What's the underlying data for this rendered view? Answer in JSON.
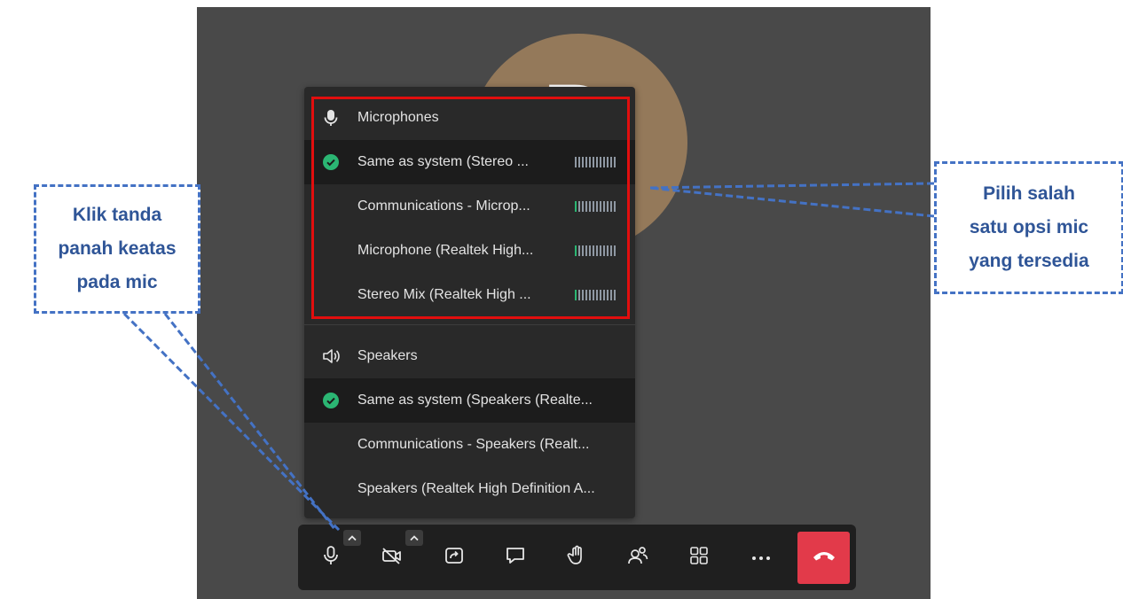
{
  "menu": {
    "microphones": {
      "header": "Microphones",
      "items": [
        {
          "label": "Same as system (Stereo ...",
          "selected": true,
          "level": 0
        },
        {
          "label": "Communications - Microp...",
          "selected": false,
          "level": 1
        },
        {
          "label": "Microphone (Realtek High...",
          "selected": false,
          "level": 1
        },
        {
          "label": "Stereo Mix (Realtek High ...",
          "selected": false,
          "level": 1
        }
      ]
    },
    "speakers": {
      "header": "Speakers",
      "items": [
        {
          "label": "Same as system (Speakers (Realte...",
          "selected": true
        },
        {
          "label": "Communications - Speakers (Realt...",
          "selected": false
        },
        {
          "label": "Speakers (Realtek High Definition A...",
          "selected": false
        }
      ]
    }
  },
  "avatar": {
    "initial": "B",
    "color": "#94795a"
  },
  "toolbar": {
    "buttons": [
      "mic-icon",
      "camera-off-icon",
      "share-screen-icon",
      "chat-icon",
      "raise-hand-icon",
      "participants-icon",
      "grid-view-icon",
      "more-icon",
      "hang-up-icon"
    ]
  },
  "annotations": {
    "left_lines": [
      "Klik tanda",
      "panah keatas",
      "pada mic"
    ],
    "right_lines": [
      "Pilih salah",
      "satu opsi mic",
      "yang tersedia"
    ]
  },
  "colors": {
    "stage_bg": "#494949",
    "menu_bg": "#292929",
    "selected_bg": "#1c1c1c",
    "check_green": "#2bb673",
    "highlight_red": "#e10e0e",
    "callout_blue": "#4472c4",
    "callout_text": "#2f5597",
    "hangup_red": "#e23a4a"
  }
}
